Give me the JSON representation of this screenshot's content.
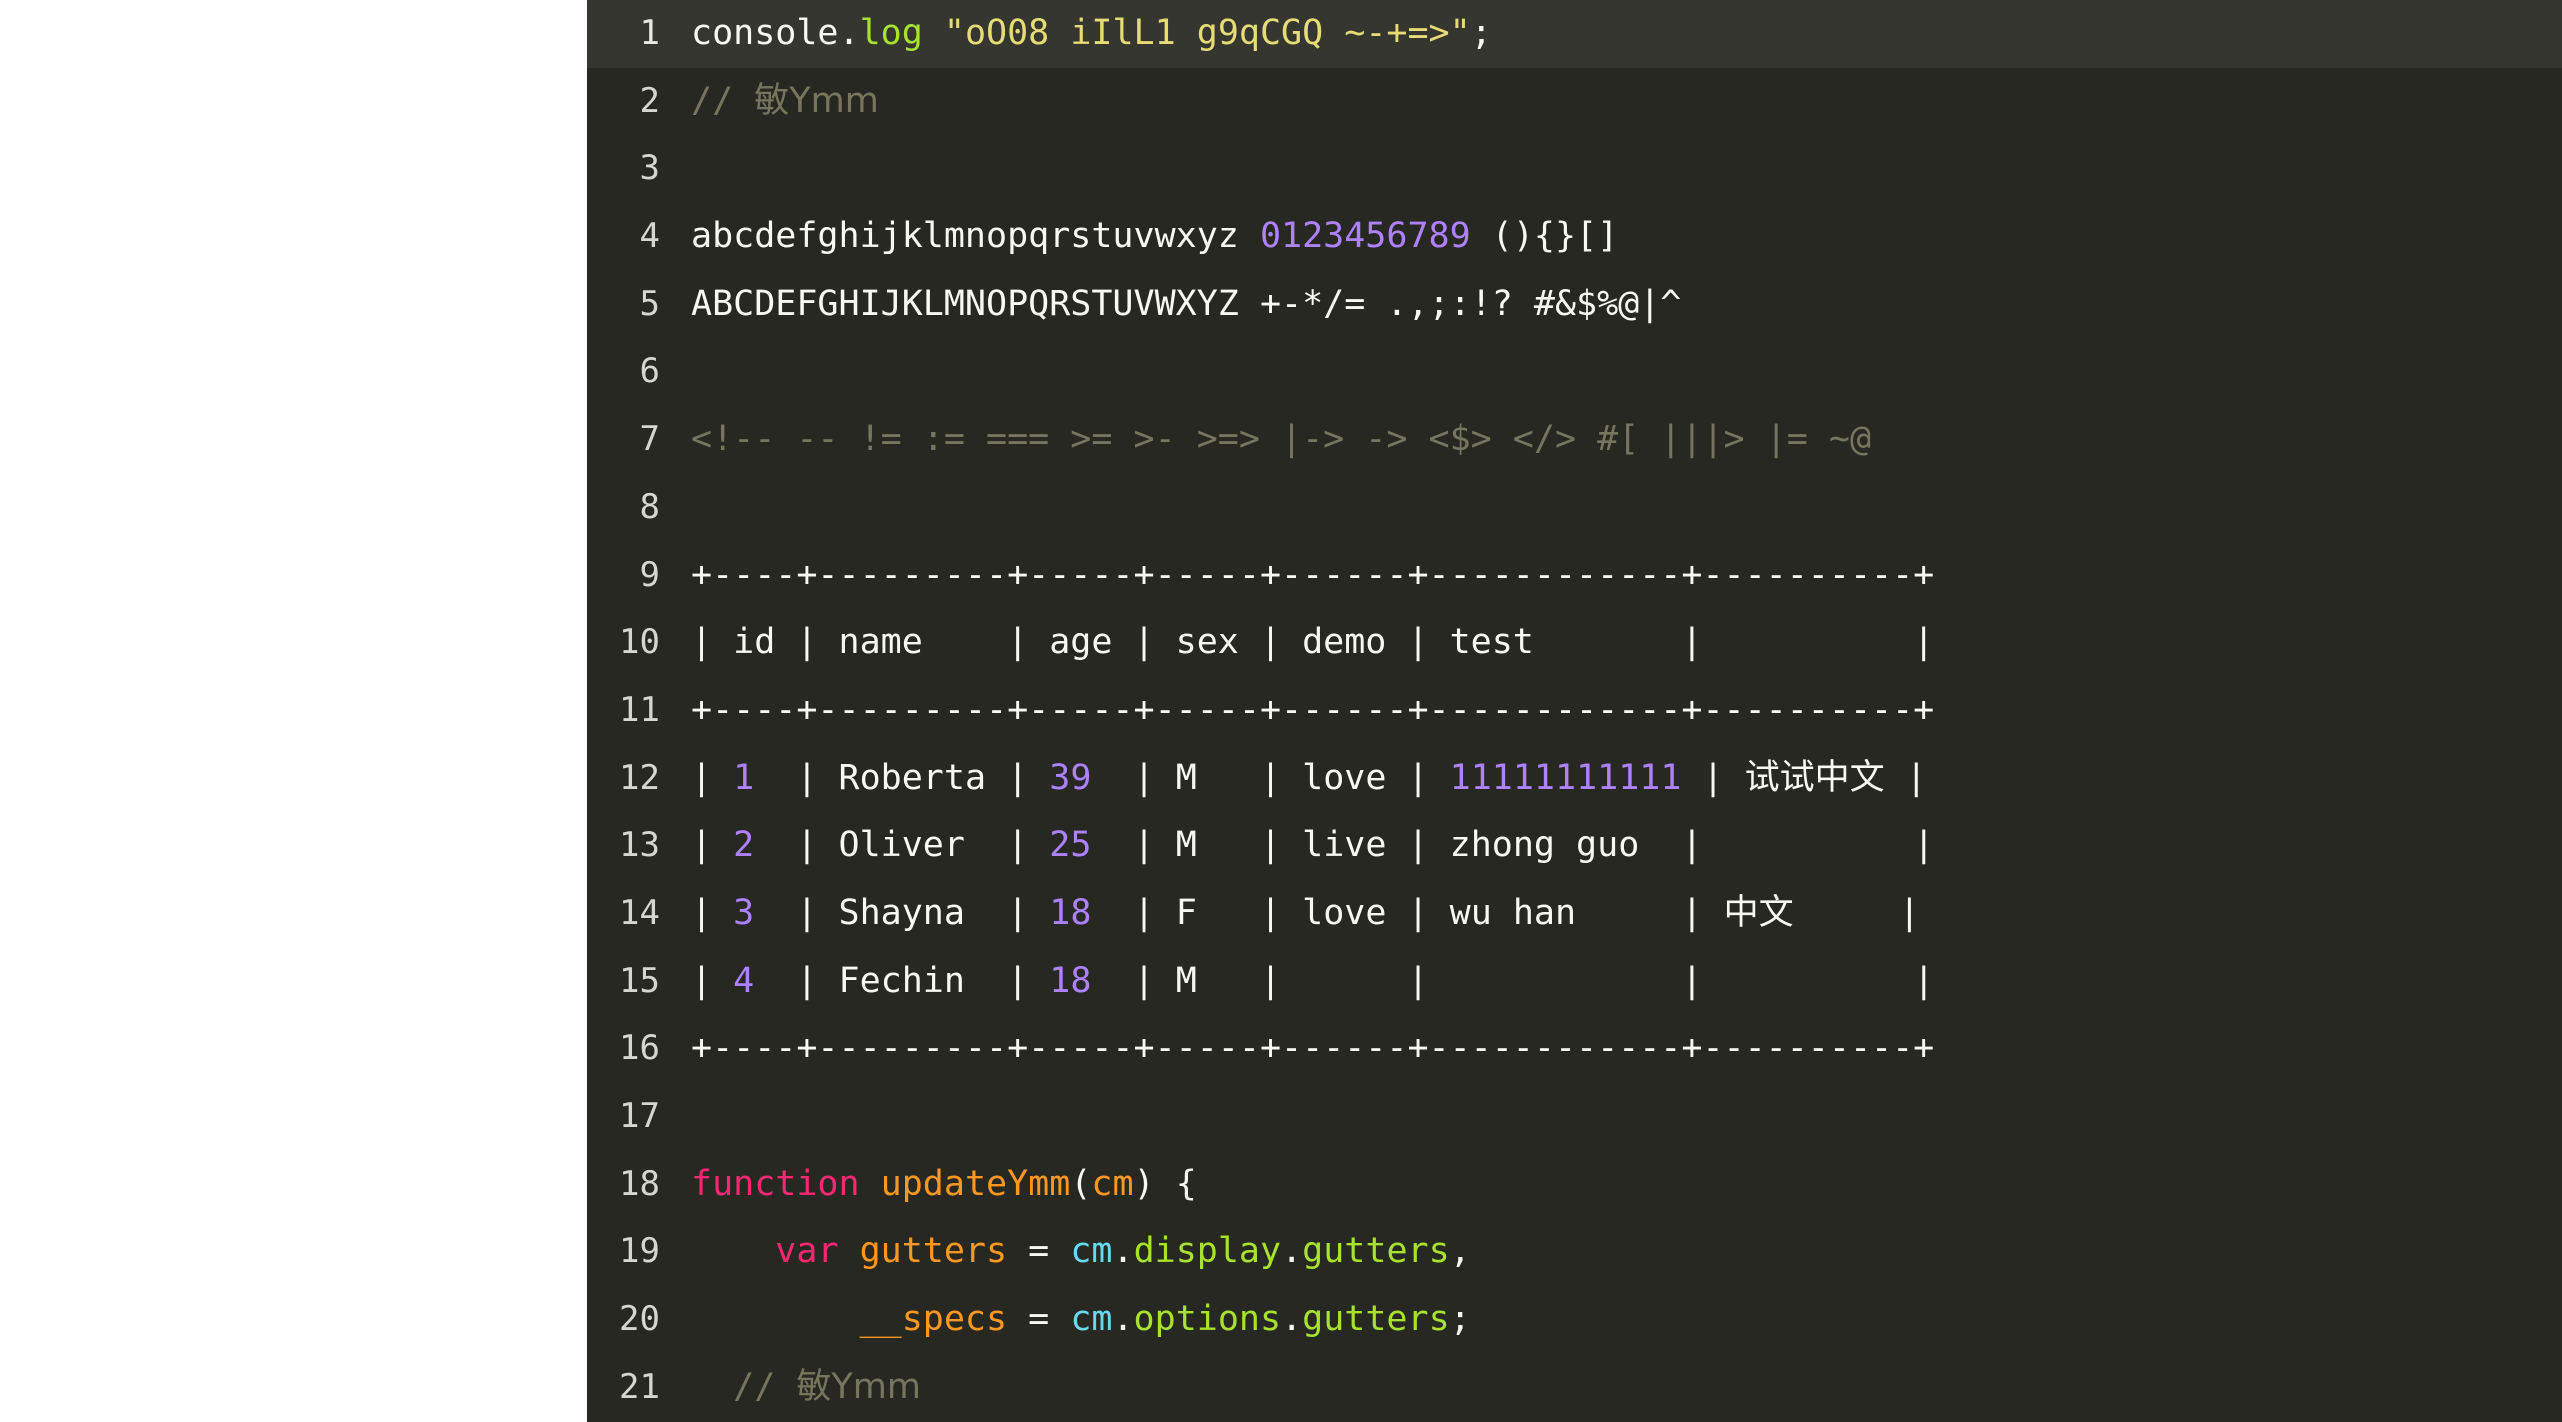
{
  "editor": {
    "theme_name": "monokai",
    "background": "#272822",
    "active_line_background": "#353630",
    "gutter_text_color": "#d6d6d0",
    "colors": {
      "plain": "#f8f8f2",
      "comment": "#76765e",
      "string": "#e6db74",
      "number": "#ae81ff",
      "keyword": "#f92672",
      "function": "#fd971f",
      "variable": "#fd971f",
      "parameter": "#66d9ef",
      "property": "#a6e22e"
    },
    "active_line": 1,
    "lines": [
      {
        "number": "1",
        "active": true,
        "tokens": [
          {
            "text": "console",
            "type": "plain"
          },
          {
            "text": ".",
            "type": "plain"
          },
          {
            "text": "log",
            "type": "property"
          },
          {
            "text": " ",
            "type": "plain"
          },
          {
            "text": "\"oO08 iIlL1 g9qCGQ ~-+=>\"",
            "type": "string"
          },
          {
            "text": ";",
            "type": "plain"
          }
        ]
      },
      {
        "number": "2",
        "active": false,
        "tokens": [
          {
            "text": "// ",
            "type": "comment"
          },
          {
            "text": "敏Ymm",
            "type": "comment",
            "cjk": true
          }
        ]
      },
      {
        "number": "3",
        "active": false,
        "tokens": []
      },
      {
        "number": "4",
        "active": false,
        "tokens": [
          {
            "text": "abcdefghijklmnopqrstuvwxyz ",
            "type": "plain"
          },
          {
            "text": "0123456789",
            "type": "number"
          },
          {
            "text": " (){}[]",
            "type": "plain"
          }
        ]
      },
      {
        "number": "5",
        "active": false,
        "tokens": [
          {
            "text": "ABCDEFGHIJKLMNOPQRSTUVWXYZ +-*/= .,;:!? #&$%@|^",
            "type": "plain"
          }
        ]
      },
      {
        "number": "6",
        "active": false,
        "tokens": []
      },
      {
        "number": "7",
        "active": false,
        "tokens": [
          {
            "text": "<!-- -- != := === >= >- >=> |-> -> <$> </> #[ |||> |= ~@",
            "type": "comment"
          }
        ]
      },
      {
        "number": "8",
        "active": false,
        "tokens": []
      },
      {
        "number": "9",
        "active": false,
        "tokens": [
          {
            "text": "+----+---------+-----+-----+------+------------+----------+",
            "type": "plain"
          }
        ]
      },
      {
        "number": "10",
        "active": false,
        "tokens": [
          {
            "text": "| id | name    | age | sex | demo | test       |          |",
            "type": "plain"
          }
        ]
      },
      {
        "number": "11",
        "active": false,
        "tokens": [
          {
            "text": "+----+---------+-----+-----+------+------------+----------+",
            "type": "plain"
          }
        ]
      },
      {
        "number": "12",
        "active": false,
        "tokens": [
          {
            "text": "| ",
            "type": "plain"
          },
          {
            "text": "1",
            "type": "number"
          },
          {
            "text": "  | Roberta | ",
            "type": "plain"
          },
          {
            "text": "39",
            "type": "number"
          },
          {
            "text": "  | M   | love | ",
            "type": "plain"
          },
          {
            "text": "11111111111",
            "type": "number"
          },
          {
            "text": " | ",
            "type": "plain"
          },
          {
            "text": "试试中文",
            "type": "plain",
            "cjk": true
          },
          {
            "text": " |",
            "type": "plain"
          }
        ]
      },
      {
        "number": "13",
        "active": false,
        "tokens": [
          {
            "text": "| ",
            "type": "plain"
          },
          {
            "text": "2",
            "type": "number"
          },
          {
            "text": "  | Oliver  | ",
            "type": "plain"
          },
          {
            "text": "25",
            "type": "number"
          },
          {
            "text": "  | M   | live | zhong guo  |          |",
            "type": "plain"
          }
        ]
      },
      {
        "number": "14",
        "active": false,
        "tokens": [
          {
            "text": "| ",
            "type": "plain"
          },
          {
            "text": "3",
            "type": "number"
          },
          {
            "text": "  | Shayna  | ",
            "type": "plain"
          },
          {
            "text": "18",
            "type": "number"
          },
          {
            "text": "  | F   | love | wu han     | ",
            "type": "plain"
          },
          {
            "text": "中文",
            "type": "plain",
            "cjk": true
          },
          {
            "text": "     |",
            "type": "plain"
          }
        ]
      },
      {
        "number": "15",
        "active": false,
        "tokens": [
          {
            "text": "| ",
            "type": "plain"
          },
          {
            "text": "4",
            "type": "number"
          },
          {
            "text": "  | Fechin  | ",
            "type": "plain"
          },
          {
            "text": "18",
            "type": "number"
          },
          {
            "text": "  | M   |      |            |          |",
            "type": "plain"
          }
        ]
      },
      {
        "number": "16",
        "active": false,
        "tokens": [
          {
            "text": "+----+---------+-----+-----+------+------------+----------+",
            "type": "plain"
          }
        ]
      },
      {
        "number": "17",
        "active": false,
        "tokens": []
      },
      {
        "number": "18",
        "active": false,
        "tokens": [
          {
            "text": "function",
            "type": "keyword"
          },
          {
            "text": " ",
            "type": "plain"
          },
          {
            "text": "updateYmm",
            "type": "function"
          },
          {
            "text": "(",
            "type": "plain"
          },
          {
            "text": "cm",
            "type": "variable"
          },
          {
            "text": ") {",
            "type": "plain"
          }
        ]
      },
      {
        "number": "19",
        "active": false,
        "tokens": [
          {
            "text": "    ",
            "type": "plain"
          },
          {
            "text": "var",
            "type": "keyword"
          },
          {
            "text": " ",
            "type": "plain"
          },
          {
            "text": "gutters",
            "type": "variable"
          },
          {
            "text": " = ",
            "type": "plain"
          },
          {
            "text": "cm",
            "type": "parameter"
          },
          {
            "text": ".",
            "type": "plain"
          },
          {
            "text": "display",
            "type": "property"
          },
          {
            "text": ".",
            "type": "plain"
          },
          {
            "text": "gutters",
            "type": "property"
          },
          {
            "text": ",",
            "type": "plain"
          }
        ]
      },
      {
        "number": "20",
        "active": false,
        "tokens": [
          {
            "text": "        ",
            "type": "plain"
          },
          {
            "text": "__specs",
            "type": "variable"
          },
          {
            "text": " = ",
            "type": "plain"
          },
          {
            "text": "cm",
            "type": "parameter"
          },
          {
            "text": ".",
            "type": "plain"
          },
          {
            "text": "options",
            "type": "property"
          },
          {
            "text": ".",
            "type": "plain"
          },
          {
            "text": "gutters",
            "type": "property"
          },
          {
            "text": ";",
            "type": "plain"
          }
        ]
      },
      {
        "number": "21",
        "active": false,
        "tokens": [
          {
            "text": "  // ",
            "type": "comment"
          },
          {
            "text": "敏Ymm",
            "type": "comment",
            "cjk": true
          }
        ]
      }
    ]
  }
}
